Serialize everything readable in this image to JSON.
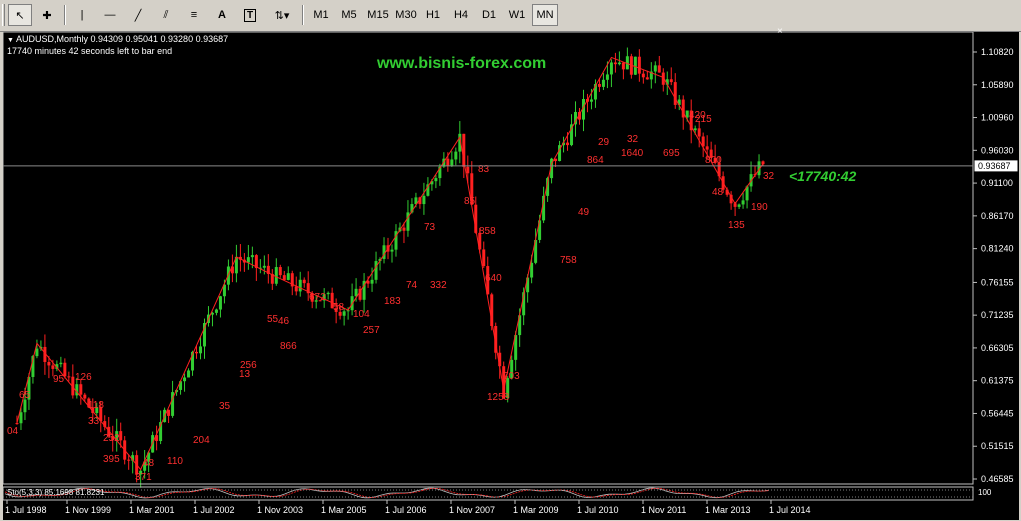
{
  "toolbar": {
    "tools": [
      {
        "name": "cursor-tool",
        "glyph": "↖"
      },
      {
        "name": "crosshair-tool",
        "glyph": "✚"
      },
      {
        "name": "vertical-line-tool",
        "glyph": "|"
      },
      {
        "name": "horizontal-line-tool",
        "glyph": "—"
      },
      {
        "name": "trendline-tool",
        "glyph": "╱"
      },
      {
        "name": "equidistant-channel-tool",
        "glyph": "⫽"
      },
      {
        "name": "fibonacci-tool",
        "glyph": "≡"
      },
      {
        "name": "text-tool",
        "glyph": "A"
      },
      {
        "name": "text-label-tool",
        "glyph": "T"
      },
      {
        "name": "arrows-tool",
        "glyph": "⇅▾"
      }
    ],
    "timeframes": [
      "M1",
      "M5",
      "M15",
      "M30",
      "H1",
      "H4",
      "D1",
      "W1",
      "MN"
    ],
    "active_timeframe": "MN"
  },
  "chart": {
    "symbol_line": "AUDUSD,Monthly  0.94309 0.95041 0.93280 0.93687",
    "bar_timer": "17740 minutes 42 seconds left to bar end",
    "website": "www.bisnis-forex.com",
    "countdown": "<17740:42",
    "close_glyph": "×",
    "current_price": "0.93687",
    "indicator_label": "Sto(5,3,3) 85.1698 81.8231",
    "indicator_scale": "100",
    "price_ticks": [
      "1.10820",
      "1.05890",
      "1.00960",
      "0.96030",
      "0.91100",
      "0.86170",
      "0.81240",
      "0.76155",
      "0.71235",
      "0.66305",
      "0.61375",
      "0.56445",
      "0.51515",
      "0.46585"
    ],
    "date_ticks": [
      "1 Jul 1998",
      "1 Nov 1999",
      "1 Mar 2001",
      "1 Jul 2002",
      "1 Nov 2003",
      "1 Mar 2005",
      "1 Jul 2006",
      "1 Nov 2007",
      "1 Mar 2009",
      "1 Jul 2010",
      "1 Nov 2011",
      "1 Mar 2013",
      "1 Jul 2014"
    ],
    "colors": {
      "background": "#000000",
      "bull": "#32cd32",
      "bear": "#ff2020",
      "zigzag": "#ff2020",
      "label": "#ff3030",
      "blue_label": "#3050ff",
      "overlay_text": "#32cd32"
    }
  },
  "chart_data": {
    "type": "candlestick",
    "symbol": "AUDUSD",
    "timeframe": "Monthly",
    "ylim": [
      0.46585,
      1.1082
    ],
    "zigzag": [
      {
        "date": "1998-08",
        "price": 0.55
      },
      {
        "date": "1999-01",
        "price": 0.67
      },
      {
        "date": "2001-03",
        "price": 0.48
      },
      {
        "date": "2003-03",
        "price": 0.8
      },
      {
        "date": "2004-01",
        "price": 0.77
      },
      {
        "date": "2005-07",
        "price": 0.72
      },
      {
        "date": "2007-11",
        "price": 0.98
      },
      {
        "date": "2008-10",
        "price": 0.6
      },
      {
        "date": "2009-10",
        "price": 0.94
      },
      {
        "date": "2011-01",
        "price": 1.1
      },
      {
        "date": "2012-02",
        "price": 1.07
      },
      {
        "date": "2013-08",
        "price": 0.88
      },
      {
        "date": "2014-03",
        "price": 0.94
      }
    ],
    "labels": [
      "04",
      "65",
      "95",
      "126",
      "118",
      "33",
      "252",
      "395",
      "371",
      "48",
      "110",
      "204",
      "35",
      "13",
      "256",
      "55",
      "46",
      "866",
      "672",
      "58",
      "104",
      "257",
      "183",
      "74",
      "332",
      "73",
      "85",
      "83",
      "858",
      "640",
      "1258",
      "703",
      "758",
      "49",
      "864",
      "29",
      "1640",
      "32",
      "695",
      "420",
      "215",
      "800",
      "48",
      "135",
      "190",
      "32"
    ],
    "stochastic": {
      "k": 85.1698,
      "d": 81.8231
    }
  }
}
